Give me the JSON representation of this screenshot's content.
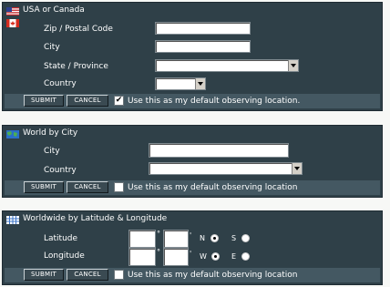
{
  "usa": {
    "title": "USA or Canada",
    "zip_label": "Zip / Postal Code",
    "zip_value": "",
    "city_label": "City",
    "city_value": "",
    "state_label": "State / Province",
    "state_selected": "",
    "country_label": "Country",
    "country_selected": "",
    "submit_label": "SUBMIT",
    "cancel_label": "CANCEL",
    "default_checked": true,
    "default_label": "Use this as my default observing location."
  },
  "world": {
    "title": "World by City",
    "city_label": "City",
    "city_value": "",
    "country_label": "Country",
    "country_selected": "",
    "submit_label": "SUBMIT",
    "cancel_label": "CANCEL",
    "default_checked": false,
    "default_label": "Use this as my default observing location"
  },
  "latlong": {
    "title": "Worldwide by Latitude & Longitude",
    "latitude_label": "Latitude",
    "longitude_label": "Longitude",
    "degree_mark": "°",
    "minute_mark": "'",
    "north_label": "N",
    "south_label": "S",
    "west_label": "W",
    "east_label": "E",
    "latitude_hemisphere": "N",
    "longitude_hemisphere": "W",
    "submit_label": "SUBMIT",
    "cancel_label": "CANCEL",
    "default_checked": false,
    "default_label": "Use this as my default observing location"
  },
  "colors": {
    "panel": "#2f4048",
    "bar": "#445862",
    "page": "#f7f8f6"
  }
}
